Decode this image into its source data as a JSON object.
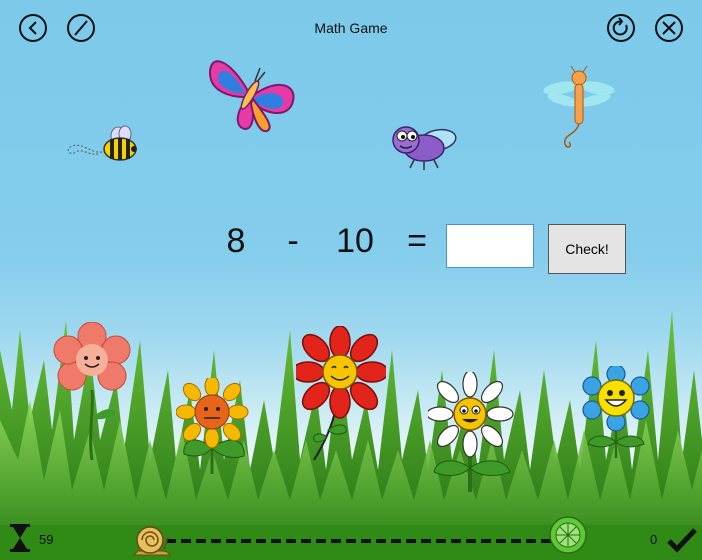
{
  "header": {
    "title": "Math Game",
    "back_icon": "back-arrow-icon",
    "pencil_icon": "slash-icon",
    "reload_icon": "reload-icon",
    "close_icon": "close-icon"
  },
  "problem": {
    "operand1": "8",
    "operator": "-",
    "operand2": "10",
    "equals": "=",
    "answer_value": "",
    "check_label": "Check!"
  },
  "footer": {
    "timer_icon": "hourglass-icon",
    "time_left": "59",
    "score": "0",
    "score_icon": "checkmark-icon",
    "progress_start_icon": "snail-icon",
    "progress_goal_icon": "cabbage-icon",
    "progress": 0
  },
  "decorations": [
    "butterfly",
    "bee",
    "fly",
    "dragonfly",
    "pink-flower",
    "sunflower",
    "red-flower",
    "daisy",
    "blue-flower"
  ],
  "colors": {
    "sky": "#7cc9ea",
    "grass": "#3e9b1c"
  }
}
